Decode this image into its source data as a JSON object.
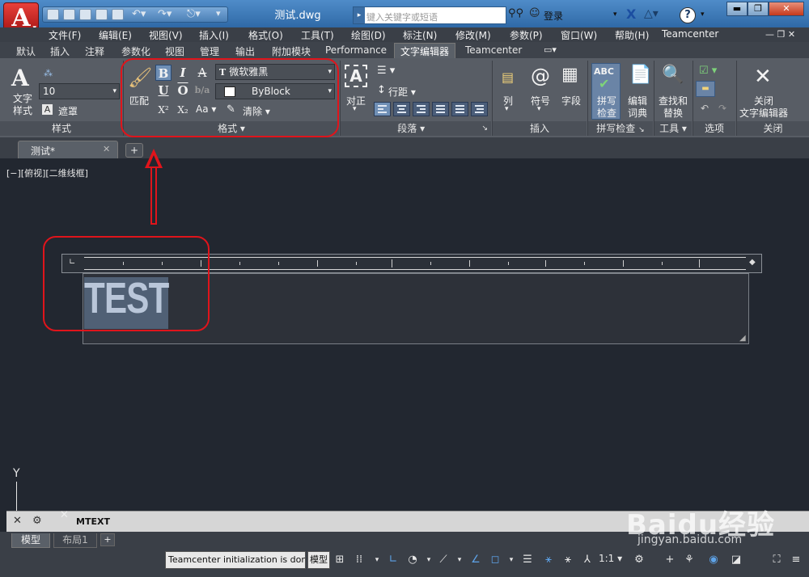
{
  "window": {
    "doc_title": "测试.dwg",
    "search_placeholder": "键入关键字或短语",
    "login": "登录"
  },
  "menu": [
    "文件(F)",
    "编辑(E)",
    "视图(V)",
    "插入(I)",
    "格式(O)",
    "工具(T)",
    "绘图(D)",
    "标注(N)",
    "修改(M)",
    "参数(P)",
    "窗口(W)",
    "帮助(H)",
    "Teamcenter"
  ],
  "ribbon_tabs": [
    "默认",
    "插入",
    "注释",
    "参数化",
    "视图",
    "管理",
    "输出",
    "附加模块",
    "Performance",
    "文字编辑器",
    "Teamcenter"
  ],
  "ribbon": {
    "style": {
      "text_style_label": "文字\n样式",
      "height_value": "10",
      "mask_label": "遮罩",
      "panel_title": "样式"
    },
    "format": {
      "match_label": "匹配",
      "font_value": "微软雅黑",
      "color_value": "ByBlock",
      "case_label": "Aa",
      "clear_label": "清除",
      "panel_title": "格式"
    },
    "paragraph": {
      "justify_label": "对正",
      "line_spacing_label": "行距",
      "panel_title": "段落"
    },
    "insert": {
      "column_label": "列",
      "symbol_label": "符号",
      "field_label": "字段",
      "panel_title": "插入"
    },
    "spellcheck": {
      "spell_label_1": "拼写",
      "spell_label_2": "检查",
      "dict_label_1": "编辑",
      "dict_label_2": "词典",
      "panel_title": "拼写检查"
    },
    "tools": {
      "find_label_1": "查找和",
      "find_label_2": "替换",
      "panel_title": "工具"
    },
    "options": {
      "panel_title": "选项"
    },
    "close": {
      "close_label_1": "关闭",
      "close_label_2": "文字编辑器",
      "panel_title": "关闭"
    }
  },
  "doc_tab": {
    "label": "测试*"
  },
  "viewport_label": "[−][俯视][二维线框]",
  "mtext": {
    "content": "TEST"
  },
  "ucs_axis": "Y",
  "command": {
    "text": "MTEXT"
  },
  "layout_tabs": [
    "模型",
    "布局1"
  ],
  "status": {
    "message": "Teamcenter initialization is done",
    "model_label": "模型",
    "scale": "1:1"
  },
  "watermark": {
    "brand": "Baidu经验",
    "url": "jingyan.baidu.com"
  },
  "colors": {
    "annotation": "#e0141b",
    "selection": "#6e86a8",
    "canvas": "#222730"
  }
}
